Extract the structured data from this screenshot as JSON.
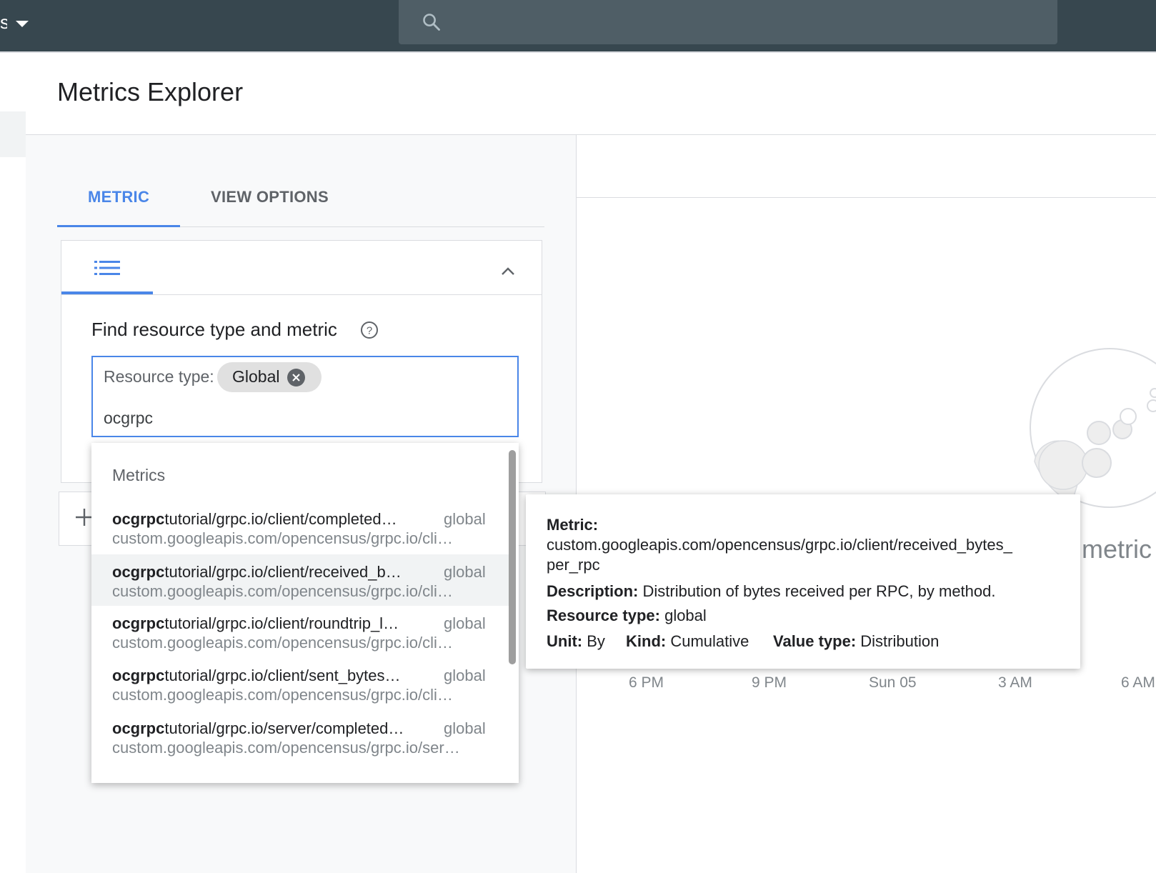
{
  "topbar": {
    "project_fragment": "s",
    "search_placeholder": ""
  },
  "header": {
    "title": "Metrics Explorer"
  },
  "tabs": [
    {
      "label": "METRIC",
      "active": true
    },
    {
      "label": "VIEW OPTIONS",
      "active": false
    }
  ],
  "query": {
    "find_label": "Find resource type and metric",
    "resource_label": "Resource type:",
    "chip_label": "Global",
    "search_text": "ocgrpc"
  },
  "dropdown": {
    "header": "Metrics",
    "items": [
      {
        "match": "ocgrpc",
        "rest": "tutorial/grpc.io/client/completed…",
        "resource": "global",
        "full": "custom.googleapis.com/opencensus/grpc.io/cli…",
        "highlighted": false
      },
      {
        "match": "ocgrpc",
        "rest": "tutorial/grpc.io/client/received_b…",
        "resource": "global",
        "full": "custom.googleapis.com/opencensus/grpc.io/cli…",
        "highlighted": true
      },
      {
        "match": "ocgrpc",
        "rest": "tutorial/grpc.io/client/roundtrip_l…",
        "resource": "global",
        "full": "custom.googleapis.com/opencensus/grpc.io/cli…",
        "highlighted": false
      },
      {
        "match": "ocgrpc",
        "rest": "tutorial/grpc.io/client/sent_bytes…",
        "resource": "global",
        "full": "custom.googleapis.com/opencensus/grpc.io/cli…",
        "highlighted": false
      },
      {
        "match": "ocgrpc",
        "rest": "tutorial/grpc.io/server/completed…",
        "resource": "global",
        "full": "custom.googleapis.com/opencensus/grpc.io/ser…",
        "highlighted": false
      }
    ]
  },
  "tooltip": {
    "metric_label": "Metric:",
    "metric_line1": "custom.googleapis.com/opencensus/grpc.io/client/received_bytes_",
    "metric_line2": "per_rpc",
    "description_label": "Description:",
    "description": "Distribution of bytes received per RPC, by method.",
    "resource_label": "Resource type:",
    "resource": "global",
    "unit_label": "Unit:",
    "unit": "By",
    "kind_label": "Kind:",
    "kind": "Cumulative",
    "value_type_label": "Value type:",
    "value_type": "Distribution"
  },
  "chart": {
    "empty_text": "metric",
    "x_ticks": [
      "6 PM",
      "9 PM",
      "Sun 05",
      "3 AM",
      "6 AM"
    ]
  },
  "colors": {
    "topbar": "#37474f",
    "accent": "#4a86e8",
    "muted": "#80868b"
  },
  "icons": [
    "search-icon",
    "list-icon",
    "chevron-up-icon",
    "help-icon",
    "close-icon",
    "add-icon"
  ]
}
